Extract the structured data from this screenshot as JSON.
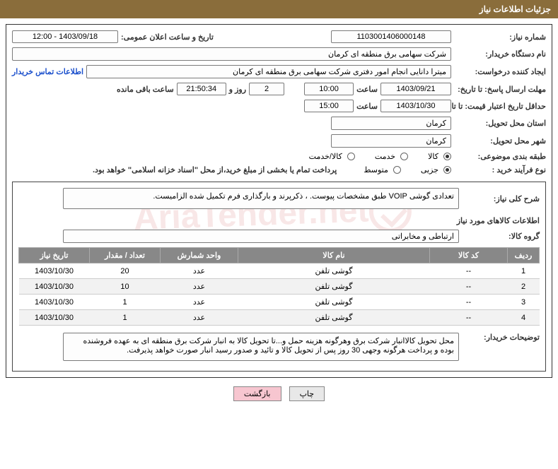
{
  "header": {
    "title": "جزئیات اطلاعات نیاز"
  },
  "fields": {
    "need_number_label": "شماره نیاز:",
    "need_number": "1103001406000148",
    "announce_date_label": "تاریخ و ساعت اعلان عمومی:",
    "announce_date": "1403/09/18 - 12:00",
    "buyer_org_label": "نام دستگاه خریدار:",
    "buyer_org": "شرکت سهامی برق منطقه ای کرمان",
    "requester_label": "ایجاد کننده درخواست:",
    "requester": "میترا دانایی انجام امور دفتری شرکت سهامی برق منطقه ای کرمان",
    "contact_link": "اطلاعات تماس خریدار",
    "deadline_label": "مهلت ارسال پاسخ: تا تاریخ:",
    "deadline_date": "1403/09/21",
    "time_label": "ساعت",
    "deadline_time": "10:00",
    "days_remain": "2",
    "days_and": "روز و",
    "time_remain": "21:50:34",
    "remain_suffix": "ساعت باقی مانده",
    "validity_label": "حداقل تاریخ اعتبار قیمت: تا تاریخ:",
    "validity_date": "1403/10/30",
    "validity_time": "15:00",
    "province_label": "استان محل تحویل:",
    "province": "کرمان",
    "city_label": "شهر محل تحویل:",
    "city": "کرمان",
    "category_label": "طبقه بندی موضوعی:",
    "cat_goods": "کالا",
    "cat_service": "خدمت",
    "cat_goods_service": "کالا/خدمت",
    "process_label": "نوع فرآیند خرید :",
    "proc_partial": "جزیی",
    "proc_medium": "متوسط",
    "payment_note": "پرداخت تمام یا بخشی از مبلغ خرید،از محل \"اسناد خزانه اسلامی\" خواهد بود.",
    "summary_label": "شرح کلی نیاز:",
    "summary": "تعدادی گوشی VOIP طبق مشخصات پیوست. ، ذکرپرند و بارگذاری فرم تکمیل شده الزامیست.",
    "items_info_title": "اطلاعات کالاهای مورد نیاز",
    "group_label": "گروه کالا:",
    "group": "ارتباطی و مخابراتی",
    "buyer_notes_label": "توضیحات خریدار:",
    "buyer_notes": "محل تحویل کالاانبار شرکت برق وهرگونه هزینه حمل و...تا تحویل کالا به انبار شرکت برق منطقه ای به عهده فروشنده بوده و پرداخت هرگونه وجهی 30 روز پس از تحویل کالا و تائید و صدور رسید انبار صورت خواهد پذیرفت."
  },
  "table": {
    "headers": {
      "row": "ردیف",
      "code": "کد کالا",
      "name": "نام کالا",
      "unit": "واحد شمارش",
      "qty": "تعداد / مقدار",
      "date": "تاریخ نیاز"
    },
    "rows": [
      {
        "row": "1",
        "code": "--",
        "name": "گوشی تلفن",
        "unit": "عدد",
        "qty": "20",
        "date": "1403/10/30"
      },
      {
        "row": "2",
        "code": "--",
        "name": "گوشی تلفن",
        "unit": "عدد",
        "qty": "10",
        "date": "1403/10/30"
      },
      {
        "row": "3",
        "code": "--",
        "name": "گوشی تلفن",
        "unit": "عدد",
        "qty": "1",
        "date": "1403/10/30"
      },
      {
        "row": "4",
        "code": "--",
        "name": "گوشی تلفن",
        "unit": "عدد",
        "qty": "1",
        "date": "1403/10/30"
      }
    ]
  },
  "buttons": {
    "print": "چاپ",
    "back": "بازگشت"
  },
  "watermark": "AriaTender.net"
}
